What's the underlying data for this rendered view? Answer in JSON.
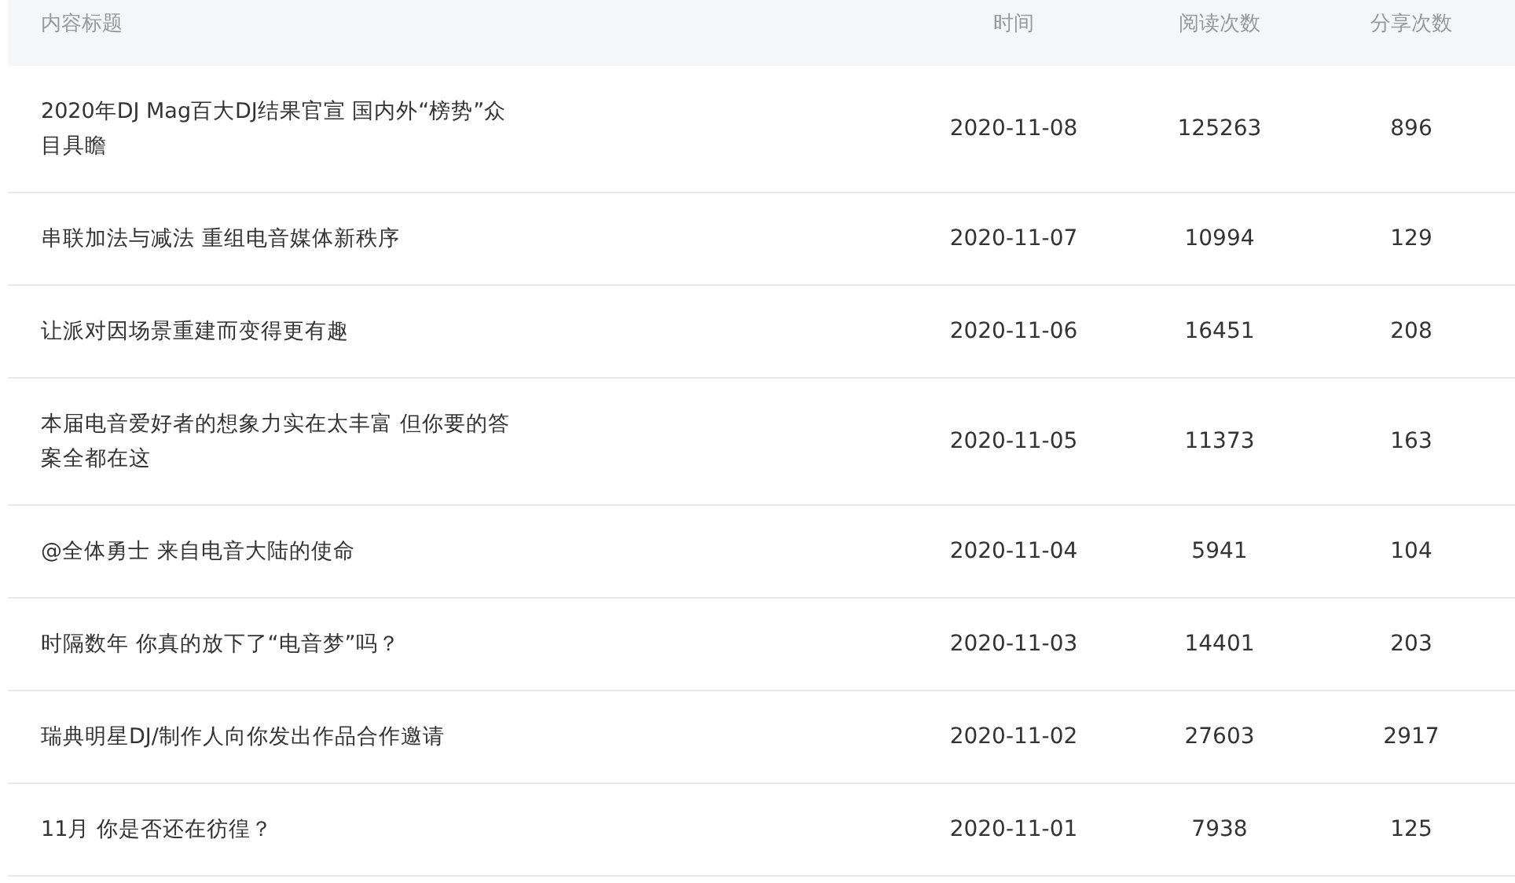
{
  "table": {
    "columns": [
      "内容标题",
      "时间",
      "阅读次数",
      "分享次数"
    ],
    "rows": [
      {
        "title": "2020年DJ Mag百大DJ结果官宣 国内外“榜势”众目具瞻",
        "time": "2020-11-08",
        "reads": "125263",
        "shares": "896"
      },
      {
        "title": "串联加法与减法 重组电音媒体新秩序",
        "time": "2020-11-07",
        "reads": "10994",
        "shares": "129"
      },
      {
        "title": "让派对因场景重建而变得更有趣",
        "time": "2020-11-06",
        "reads": "16451",
        "shares": "208"
      },
      {
        "title": "本届电音爱好者的想象力实在太丰富 但你要的答案全都在这",
        "time": "2020-11-05",
        "reads": "11373",
        "shares": "163"
      },
      {
        "title": "@全体勇士 来自电音大陆的使命",
        "time": "2020-11-04",
        "reads": "5941",
        "shares": "104"
      },
      {
        "title": "时隔数年 你真的放下了“电音梦”吗？",
        "time": "2020-11-03",
        "reads": "14401",
        "shares": "203"
      },
      {
        "title": "瑞典明星DJ/制作人向你发出作品合作邀请",
        "time": "2020-11-02",
        "reads": "27603",
        "shares": "2917"
      },
      {
        "title": "11月 你是否还在彷徨？",
        "time": "2020-11-01",
        "reads": "7938",
        "shares": "125"
      }
    ]
  }
}
